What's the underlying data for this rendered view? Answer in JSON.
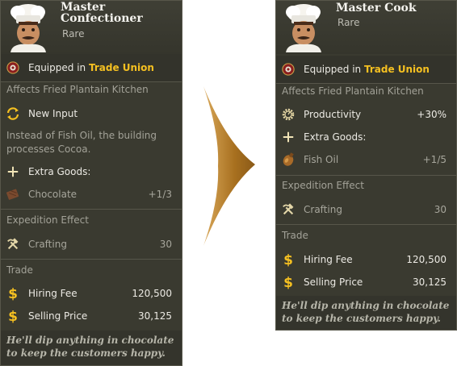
{
  "left_card": {
    "name": "Master Confectioner",
    "rarity": "Rare",
    "equipped_prefix": "Equipped in",
    "equipped_location": "Trade Union",
    "affects": "Affects Fried Plantain Kitchen",
    "new_input_label": "New Input",
    "new_input_desc": "Instead of Fish Oil, the building processes Cocoa.",
    "extra_goods_label": "Extra Goods:",
    "extra_good_name": "Chocolate",
    "extra_good_value": "+1/3",
    "expedition_header": "Expedition Effect",
    "expedition_skill": "Crafting",
    "expedition_value": "30",
    "trade_header": "Trade",
    "hiring_fee_label": "Hiring Fee",
    "hiring_fee_value": "120,500",
    "selling_price_label": "Selling Price",
    "selling_price_value": "30,125",
    "flavor": "He'll dip anything in chocolate to keep the customers happy."
  },
  "right_card": {
    "name": "Master Cook",
    "rarity": "Rare",
    "equipped_prefix": "Equipped in",
    "equipped_location": "Trade Union",
    "affects": "Affects Fried Plantain Kitchen",
    "productivity_label": "Productivity",
    "productivity_value": "+30%",
    "extra_goods_label": "Extra Goods:",
    "extra_good_name": "Fish Oil",
    "extra_good_value": "+1/5",
    "expedition_header": "Expedition Effect",
    "expedition_skill": "Crafting",
    "expedition_value": "30",
    "trade_header": "Trade",
    "hiring_fee_label": "Hiring Fee",
    "hiring_fee_value": "120,500",
    "selling_price_label": "Selling Price",
    "selling_price_value": "30,125",
    "flavor": "He'll dip anything in chocolate to keep the customers happy."
  },
  "colors": {
    "panel": "#3a3a30",
    "accent_gold": "#f5c021",
    "arrow": "#b07a2a"
  },
  "icons": [
    "chef-portrait",
    "trade-union-icon",
    "cycle-arrows-icon",
    "plus-icon",
    "chocolate-icon",
    "hammer-pickaxe-icon",
    "dollar-icon",
    "gear-productivity-icon",
    "fish-oil-icon",
    "comparison-arrow"
  ]
}
